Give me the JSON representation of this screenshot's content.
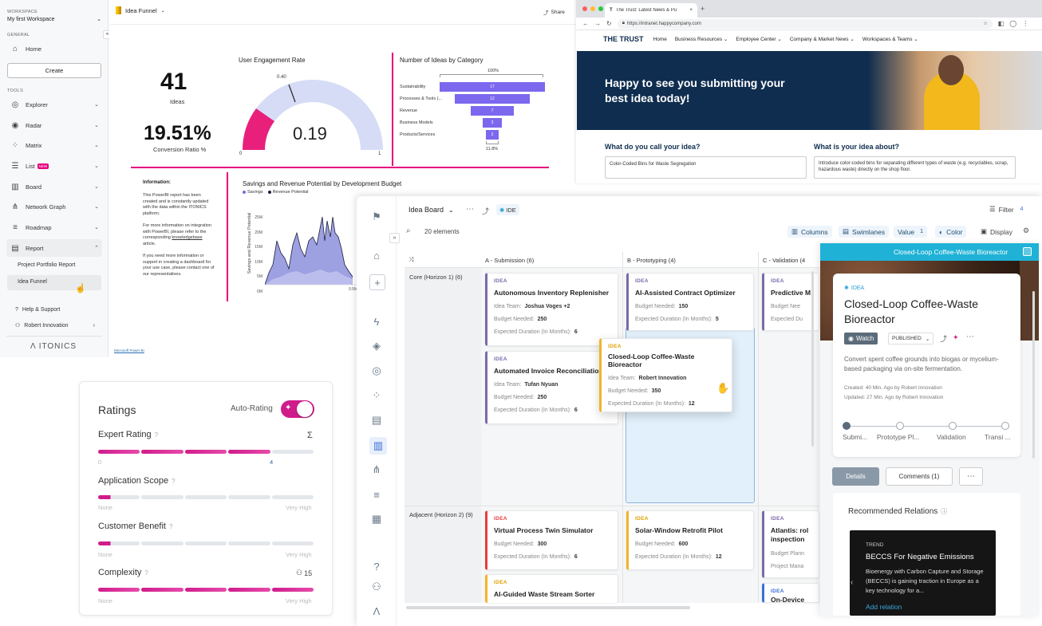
{
  "sidebar": {
    "workspace_label": "WORKSPACE",
    "workspace_name": "My first Workspace",
    "general_label": "GENERAL",
    "home": "Home",
    "create": "Create",
    "tools_label": "TOOLS",
    "tools": [
      {
        "label": "Explorer",
        "icon": "explorer-icon"
      },
      {
        "label": "Radar",
        "icon": "radar-icon"
      },
      {
        "label": "Matrix",
        "icon": "matrix-icon"
      },
      {
        "label": "List",
        "icon": "list-icon",
        "badge": "NEW"
      },
      {
        "label": "Board",
        "icon": "board-icon"
      },
      {
        "label": "Network Graph",
        "icon": "network-graph-icon"
      },
      {
        "label": "Roadmap",
        "icon": "roadmap-icon"
      },
      {
        "label": "Report",
        "icon": "report-icon"
      }
    ],
    "report_children": [
      "Project Portfolio Report",
      "Idea Funnel"
    ],
    "help": "Help & Support",
    "user": "Robert Innovation",
    "logo": "ITONICS"
  },
  "report": {
    "title": "Idea Funnel",
    "share": "Share",
    "ideas_value": "41",
    "ideas_label": "Ideas",
    "conversion_value": "19.51%",
    "conversion_label": "Conversion Ratio %",
    "gauge": {
      "title": "User Engagement Rate",
      "value": "0.19",
      "target": "0.40",
      "min": "0",
      "max": "1"
    },
    "funnel": {
      "title": "Number of Ideas by Category",
      "top_label": "100%",
      "bottom_label": "11.8%",
      "rows": [
        {
          "label": "Sustainability",
          "value": "17"
        },
        {
          "label": "Processes & Tools (...",
          "value": "12"
        },
        {
          "label": "Revenue",
          "value": "7"
        },
        {
          "label": "Business Models",
          "value": "3"
        },
        {
          "label": "Products/Services",
          "value": "2"
        }
      ]
    },
    "info_title": "Information:",
    "info_p1": "This PowerBI report has been created and is constantly updated with the data within the ITONICS platform.",
    "info_p2a": "For more information on integration with PowerBI, please refer to the corresponding ",
    "info_p2_link": "knowledgebase",
    "info_p2b": " article.",
    "info_p3": "If you need more information or support in creating a dashboard for your use case, please contact one of our representatives.",
    "footer": "Microsoft Power BI",
    "area_chart": {
      "title": "Savings and Revenue Potential by Development Budget",
      "legend": [
        "Savings",
        "Revenue Potential"
      ],
      "ylabel": "Savings and Revenue Potential",
      "yticks": [
        "25M",
        "20M",
        "15M",
        "10M",
        "5M",
        "0M"
      ],
      "xtick_last": "0.5M"
    }
  },
  "intranet": {
    "tab_title": "The Trust: Latest News & Pu",
    "url": "https://intranet.happycompany.com",
    "brand": "THE TRUST",
    "nav": [
      "Home",
      "Business Resources",
      "Employee Center",
      "Company & Market News",
      "Workspaces & Teams"
    ],
    "hero": "Happy to see you submitting your best idea today!",
    "q1": "What do you call your idea?",
    "a1": "Color-Coded Bins for Waste Segregation",
    "q2": "What is your idea about?",
    "a2": "Introduce color-coded bins for separating different types of waste (e.g. recyclables, scrap, hazardous waste) directly on the shop floor."
  },
  "ratings": {
    "title": "Ratings",
    "auto_label": "Auto-Rating",
    "items": [
      {
        "label": "Expert Rating",
        "filled": 4,
        "min": "0",
        "max": "4",
        "extra": "Σ"
      },
      {
        "label": "Application Scope",
        "filled": 0.2,
        "min": "None",
        "max": "Very High"
      },
      {
        "label": "Customer Benefit",
        "filled": 0.3,
        "min": "None",
        "max": "Very High"
      },
      {
        "label": "Complexity",
        "filled": 5,
        "min": "None",
        "max": "Very High",
        "extra": "15"
      }
    ]
  },
  "board": {
    "title": "Idea Board",
    "ide_tag": "IDE",
    "filter": "Filter",
    "filter_count": "4",
    "elements": "20 elements",
    "toolbar": {
      "columns": "Columns",
      "swimlanes": "Swimlanes",
      "value": "Value",
      "value_count": "1",
      "color": "Color",
      "display": "Display"
    },
    "columns": [
      "A - Submission (6)",
      "B - Prototyping (4)",
      "C - Validation (4"
    ],
    "lanes": [
      "Core (Horizon 1) (6)",
      "Adjacent (Horizon 2) (9)"
    ],
    "card_tag": "IDEA",
    "team_label": "Idea Team:",
    "budget_label": "Budget Needed:",
    "duration_label": "Expected Duration (In Months):",
    "cards": {
      "c1": {
        "title": "Autonomous Inventory Replenisher",
        "team": "Joshua Voges +2",
        "budget": "250",
        "duration": "6"
      },
      "c2": {
        "title": "Automated Invoice Reconciliation",
        "team": "Tufan Nyuan",
        "budget": "250",
        "duration": "6"
      },
      "c3": {
        "title": "AI-Assisted Contract Optimizer",
        "budget": "150",
        "duration": "5"
      },
      "c4": {
        "title": "Closed-Loop Coffee-Waste Bioreactor",
        "team": "Robert Innovation",
        "budget": "350",
        "duration": "12"
      },
      "c5": {
        "title": "Predictive M",
        "budget_trunc": "Budget Nee",
        "dur_trunc": "Expected Du"
      },
      "c6": {
        "title": "Virtual Process Twin Simulator",
        "budget": "300",
        "duration": "6"
      },
      "c7": {
        "title": "AI-Guided Waste Stream Sorter"
      },
      "c8": {
        "title": "Solar-Window Retrofit Pilot",
        "budget": "600",
        "duration": "12"
      },
      "c9": {
        "title": "Atlantis: rol inspection",
        "budget_trunc": "Budget Plann",
        "proj_trunc": "Project Mana"
      },
      "c10": {
        "title": "On-Device"
      }
    }
  },
  "detail": {
    "header": "Closed-Loop Coffee-Waste Bioreactor",
    "tag": "IDEA",
    "title": "Closed-Loop Coffee-Waste Bioreactor",
    "watch": "Watch",
    "status": "PUBLISHED",
    "description": "Convert spent coffee grounds into biogas or mycelium-based packaging via on-site fermentation.",
    "created": "Created: 40 Min. Ago by Robert Innovation",
    "updated": "Updated: 27 Min. Ago by Robert Innovation",
    "steps": [
      "Submi...",
      "Prototype Pl...",
      "Validation",
      "Transi ..."
    ],
    "tab_details": "Details",
    "tab_comments": "Comments (1)",
    "relations_title": "Recommended Relations",
    "trend_tag": "TREND",
    "trend_title": "BECCS For Negative Emissions",
    "trend_text": "Bioenergy with Carbon Capture and Storage (BECCS) is gaining traction in Europe as a key technology for a...",
    "add_relation": "Add relation"
  }
}
